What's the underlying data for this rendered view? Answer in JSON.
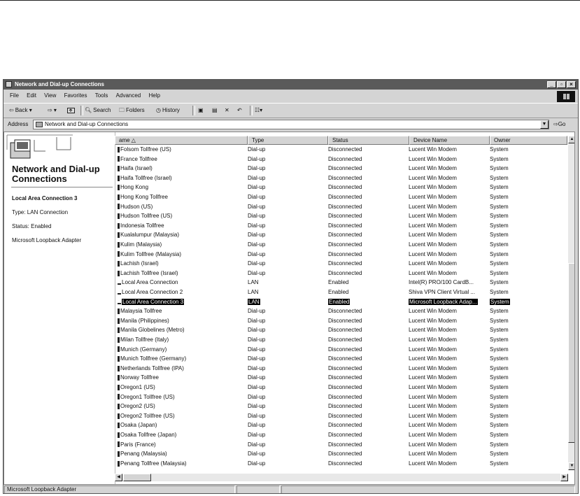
{
  "window": {
    "title": "Network and Dial-up Connections"
  },
  "menu": [
    "File",
    "Edit",
    "View",
    "Favorites",
    "Tools",
    "Advanced",
    "Help"
  ],
  "toolbar": {
    "back": "Back",
    "search": "Search",
    "folders": "Folders",
    "history": "History"
  },
  "address": {
    "label": "Address",
    "value": "Network and Dial-up Connections",
    "go": "Go"
  },
  "panel": {
    "title": "Network and Dial-up Connections",
    "selected_name": "Local Area Connection 3",
    "type_line": "Type: LAN Connection",
    "status_line": "Status: Enabled",
    "device_line": "Microsoft Loopback Adapter"
  },
  "columns": [
    "ame",
    "Type",
    "Status",
    "Device Name",
    "Owner"
  ],
  "rows": [
    {
      "name": "Folsom Tollfree (US)",
      "type": "Dial-up",
      "status": "Disconnected",
      "device": "Lucent Win Modem",
      "owner": "System",
      "icon": "dialup"
    },
    {
      "name": "France Tollfree",
      "type": "Dial-up",
      "status": "Disconnected",
      "device": "Lucent Win Modem",
      "owner": "System",
      "icon": "dialup"
    },
    {
      "name": "Haifa (Israel)",
      "type": "Dial-up",
      "status": "Disconnected",
      "device": "Lucent Win Modem",
      "owner": "System",
      "icon": "dialup"
    },
    {
      "name": "Haifa Tollfree (Israel)",
      "type": "Dial-up",
      "status": "Disconnected",
      "device": "Lucent Win Modem",
      "owner": "System",
      "icon": "dialup"
    },
    {
      "name": "Hong Kong",
      "type": "Dial-up",
      "status": "Disconnected",
      "device": "Lucent Win Modem",
      "owner": "System",
      "icon": "dialup"
    },
    {
      "name": "Hong Kong Tollfree",
      "type": "Dial-up",
      "status": "Disconnected",
      "device": "Lucent Win Modem",
      "owner": "System",
      "icon": "dialup"
    },
    {
      "name": "Hudson (US)",
      "type": "Dial-up",
      "status": "Disconnected",
      "device": "Lucent Win Modem",
      "owner": "System",
      "icon": "dialup"
    },
    {
      "name": "Hudson Tollfree (US)",
      "type": "Dial-up",
      "status": "Disconnected",
      "device": "Lucent Win Modem",
      "owner": "System",
      "icon": "dialup"
    },
    {
      "name": "Indonesia Tollfree",
      "type": "Dial-up",
      "status": "Disconnected",
      "device": "Lucent Win Modem",
      "owner": "System",
      "icon": "dialup"
    },
    {
      "name": "Kualalumpur (Malaysia)",
      "type": "Dial-up",
      "status": "Disconnected",
      "device": "Lucent Win Modem",
      "owner": "System",
      "icon": "dialup"
    },
    {
      "name": "Kulim (Malaysia)",
      "type": "Dial-up",
      "status": "Disconnected",
      "device": "Lucent Win Modem",
      "owner": "System",
      "icon": "dialup"
    },
    {
      "name": "Kulim Tollfree (Malaysia)",
      "type": "Dial-up",
      "status": "Disconnected",
      "device": "Lucent Win Modem",
      "owner": "System",
      "icon": "dialup"
    },
    {
      "name": "Lachish (Israel)",
      "type": "Dial-up",
      "status": "Disconnected",
      "device": "Lucent Win Modem",
      "owner": "System",
      "icon": "dialup"
    },
    {
      "name": "Lachish Tollfree (Israel)",
      "type": "Dial-up",
      "status": "Disconnected",
      "device": "Lucent Win Modem",
      "owner": "System",
      "icon": "dialup"
    },
    {
      "name": "Local Area Connection",
      "type": "LAN",
      "status": "Enabled",
      "device": "Intel(R) PRO/100 CardB...",
      "owner": "System",
      "icon": "lan"
    },
    {
      "name": "Local Area Connection 2",
      "type": "LAN",
      "status": "Enabled",
      "device": "Shiva VPN Client Virtual ...",
      "owner": "System",
      "icon": "lan"
    },
    {
      "name": "Local Area Connection 3",
      "type": "LAN",
      "status": "Enabled",
      "device": "Microsoft Loopback Adap...",
      "owner": "System",
      "icon": "lan",
      "selected": true
    },
    {
      "name": "Malaysia Tollfree",
      "type": "Dial-up",
      "status": "Disconnected",
      "device": "Lucent Win Modem",
      "owner": "System",
      "icon": "dialup"
    },
    {
      "name": "Manila (Philippines)",
      "type": "Dial-up",
      "status": "Disconnected",
      "device": "Lucent Win Modem",
      "owner": "System",
      "icon": "dialup"
    },
    {
      "name": "Manila Globelines (Metro)",
      "type": "Dial-up",
      "status": "Disconnected",
      "device": "Lucent Win Modem",
      "owner": "System",
      "icon": "dialup"
    },
    {
      "name": "Milan Tollfree (Italy)",
      "type": "Dial-up",
      "status": "Disconnected",
      "device": "Lucent Win Modem",
      "owner": "System",
      "icon": "dialup"
    },
    {
      "name": "Munich (Germany)",
      "type": "Dial-up",
      "status": "Disconnected",
      "device": "Lucent Win Modem",
      "owner": "System",
      "icon": "dialup"
    },
    {
      "name": "Munich Tollfree (Germany)",
      "type": "Dial-up",
      "status": "Disconnected",
      "device": "Lucent Win Modem",
      "owner": "System",
      "icon": "dialup"
    },
    {
      "name": "Netherlands Tollfree (IPA)",
      "type": "Dial-up",
      "status": "Disconnected",
      "device": "Lucent Win Modem",
      "owner": "System",
      "icon": "dialup"
    },
    {
      "name": "Norway Tollfree",
      "type": "Dial-up",
      "status": "Disconnected",
      "device": "Lucent Win Modem",
      "owner": "System",
      "icon": "dialup"
    },
    {
      "name": "Oregon1 (US)",
      "type": "Dial-up",
      "status": "Disconnected",
      "device": "Lucent Win Modem",
      "owner": "System",
      "icon": "dialup"
    },
    {
      "name": "Oregon1 Tollfree (US)",
      "type": "Dial-up",
      "status": "Disconnected",
      "device": "Lucent Win Modem",
      "owner": "System",
      "icon": "dialup"
    },
    {
      "name": "Oregon2 (US)",
      "type": "Dial-up",
      "status": "Disconnected",
      "device": "Lucent Win Modem",
      "owner": "System",
      "icon": "dialup"
    },
    {
      "name": "Oregon2 Tollfree (US)",
      "type": "Dial-up",
      "status": "Disconnected",
      "device": "Lucent Win Modem",
      "owner": "System",
      "icon": "dialup"
    },
    {
      "name": "Osaka (Japan)",
      "type": "Dial-up",
      "status": "Disconnected",
      "device": "Lucent Win Modem",
      "owner": "System",
      "icon": "dialup"
    },
    {
      "name": "Osaka Tollfree (Japan)",
      "type": "Dial-up",
      "status": "Disconnected",
      "device": "Lucent Win Modem",
      "owner": "System",
      "icon": "dialup"
    },
    {
      "name": "Paris (France)",
      "type": "Dial-up",
      "status": "Disconnected",
      "device": "Lucent Win Modem",
      "owner": "System",
      "icon": "dialup"
    },
    {
      "name": "Penang (Malaysia)",
      "type": "Dial-up",
      "status": "Disconnected",
      "device": "Lucent Win Modem",
      "owner": "System",
      "icon": "dialup"
    },
    {
      "name": "Penang Tollfree (Malaysia)",
      "type": "Dial-up",
      "status": "Disconnected",
      "device": "Lucent Win Modem",
      "owner": "System",
      "icon": "dialup"
    }
  ],
  "statusbar": {
    "text": "Microsoft Loopback Adapter"
  }
}
